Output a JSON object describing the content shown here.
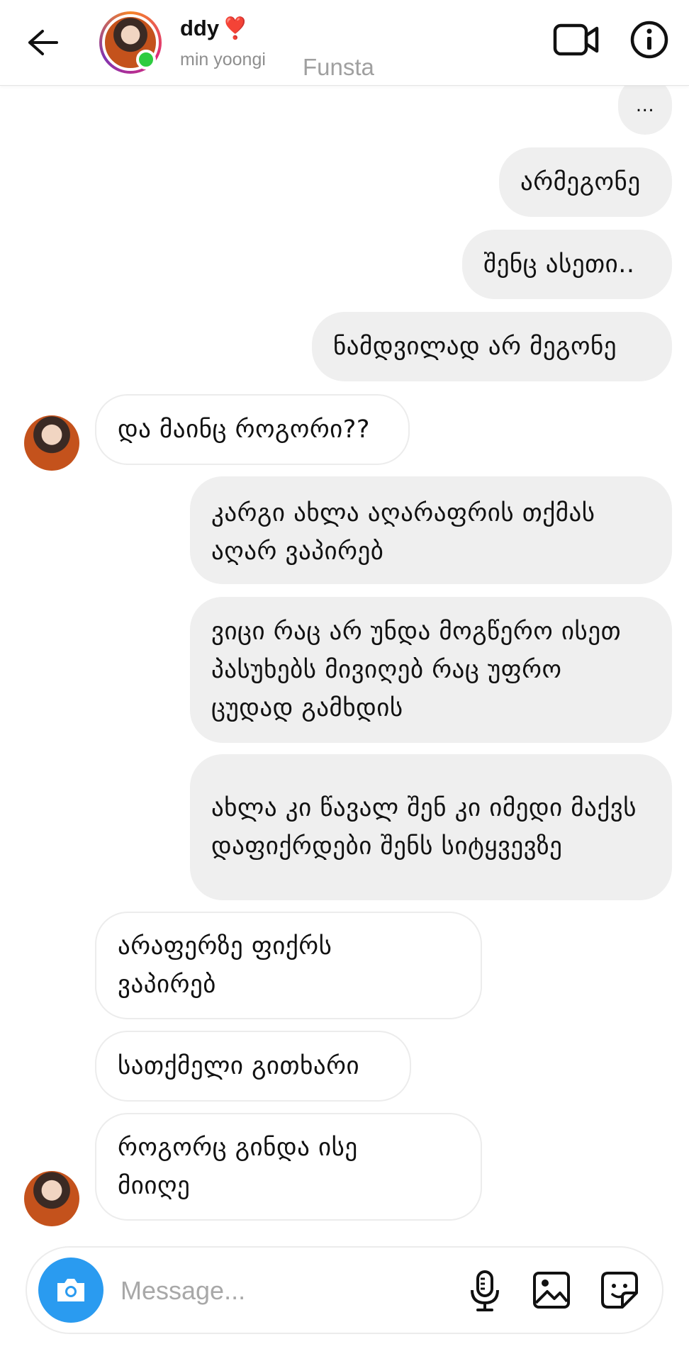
{
  "header": {
    "name": "ddy",
    "name_emoji": "❣️",
    "subtitle": "min yoongi",
    "extra_label": "Funsta"
  },
  "messages": [
    {
      "direction": "out",
      "text": "..."
    },
    {
      "direction": "out",
      "text": "არმეგონე"
    },
    {
      "direction": "out",
      "text": "შენც ასეთი.."
    },
    {
      "direction": "out",
      "text": "ნამდვილად არ მეგონე"
    },
    {
      "direction": "in",
      "text": "და მაინც როგორი??"
    },
    {
      "direction": "out",
      "text": "კარგი ახლა აღარაფრის თქმას აღარ ვაპირებ"
    },
    {
      "direction": "out",
      "text": "ვიცი რაც არ უნდა მოგწერო ისეთ პასუხებს მივიღებ რაც უფრო ცუდად გამხდის"
    },
    {
      "direction": "out",
      "text": "ახლა კი წავალ შენ კი იმედი მაქვს დაფიქრდები შენს სიტყვევზე"
    },
    {
      "direction": "in",
      "text": "არაფერზე ფიქრს ვაპირებ"
    },
    {
      "direction": "in",
      "text": "სათქმელი გითხარი"
    },
    {
      "direction": "in",
      "text": "როგორც გინდა ისე მიიღე"
    }
  ],
  "composer": {
    "placeholder": "Message..."
  },
  "icons": {
    "back": "arrow-left-icon",
    "video": "video-camera-icon",
    "info": "info-icon",
    "camera": "camera-icon",
    "mic": "microphone-icon",
    "gallery": "image-icon",
    "sticker": "sticker-icon"
  },
  "colors": {
    "outgoing_bubble": "#efefef",
    "camera_button": "#2a9bf0",
    "online": "#2ecc40"
  }
}
